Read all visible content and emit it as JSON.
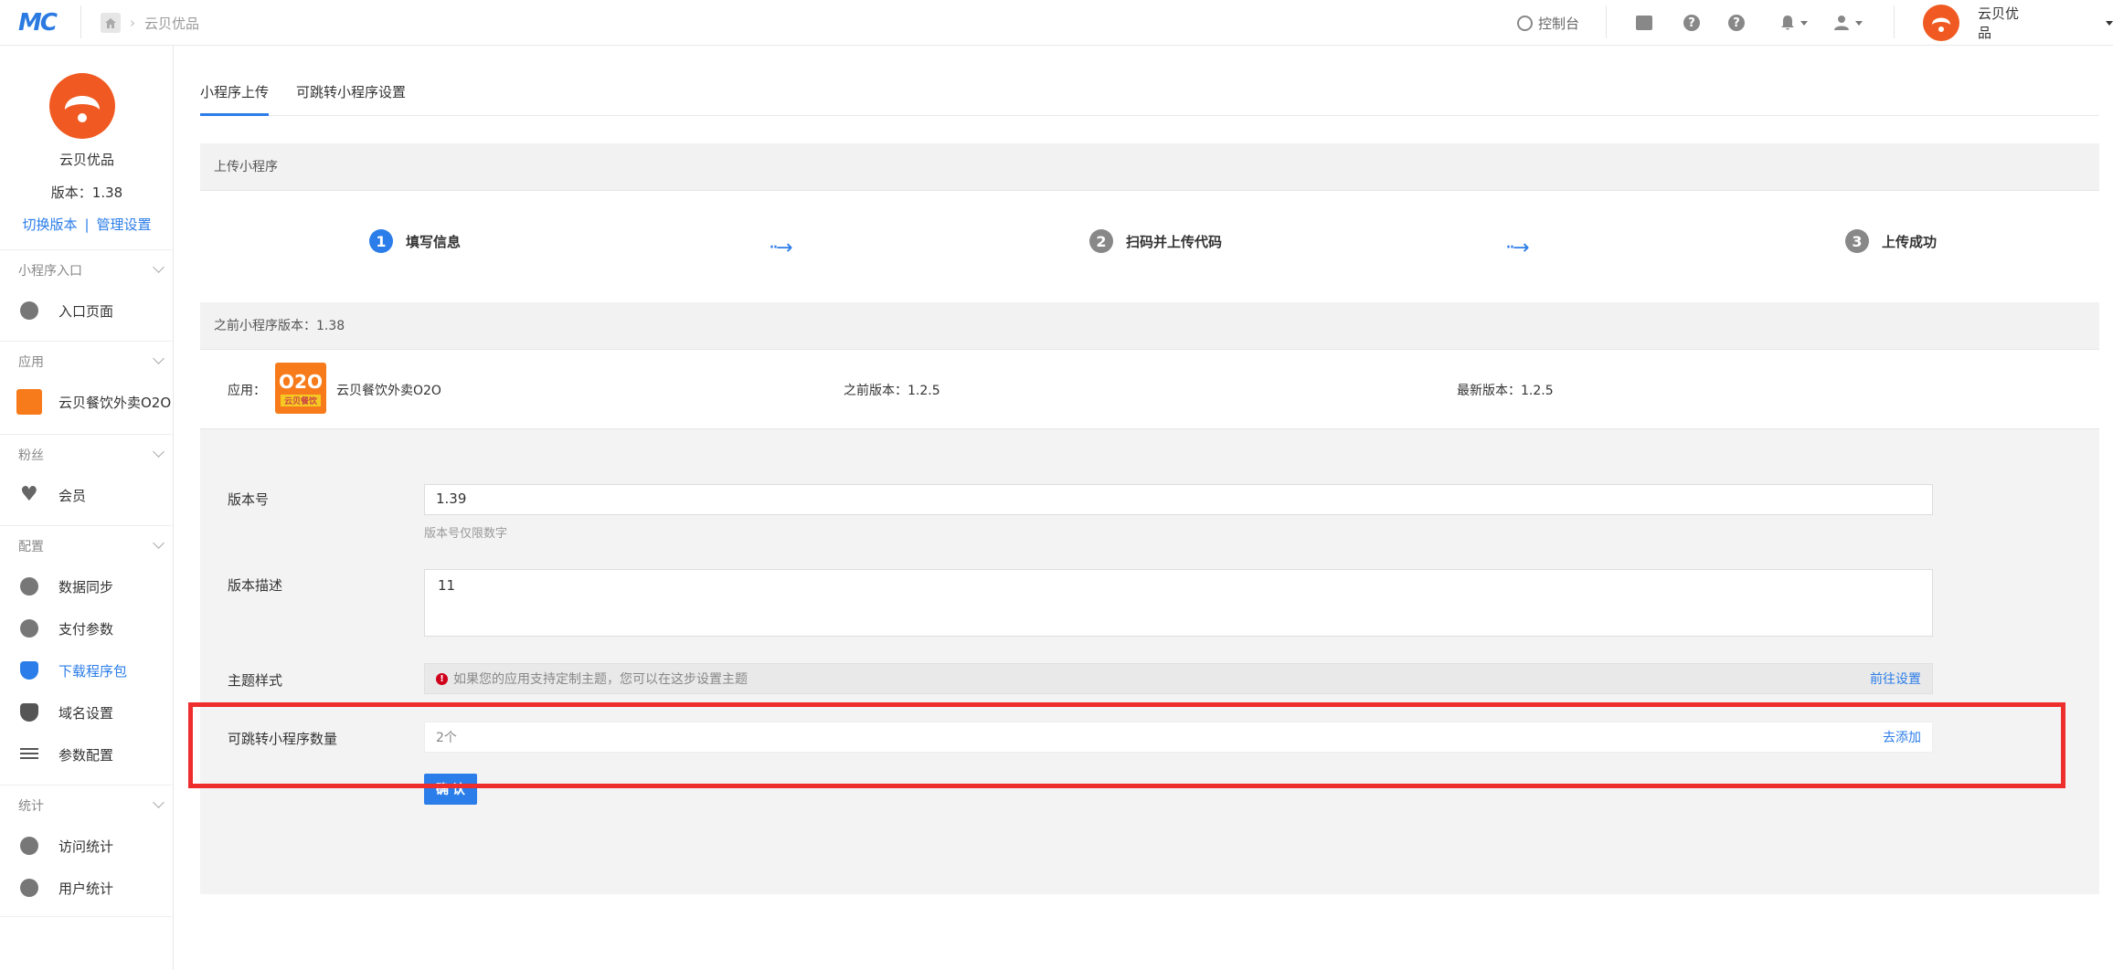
{
  "topbar": {
    "logo": "MC",
    "breadcrumb": "云贝优品",
    "console_label": "控制台",
    "account_name": "云贝优品"
  },
  "sidebar": {
    "store_name": "云贝优品",
    "version_label": "版本：1.38",
    "switch_version": "切换版本",
    "link_separator": "|",
    "manage_settings": "管理设置",
    "groups": [
      {
        "title": "小程序入口",
        "items": [
          {
            "label": "入口页面",
            "icon": "link-icon"
          }
        ]
      },
      {
        "title": "应用",
        "items": [
          {
            "label": "云贝餐饮外卖O2O",
            "icon": "o2o-app-icon"
          }
        ]
      },
      {
        "title": "粉丝",
        "items": [
          {
            "label": "会员",
            "icon": "heart-icon"
          }
        ]
      },
      {
        "title": "配置",
        "items": [
          {
            "label": "数据同步",
            "icon": "link-icon"
          },
          {
            "label": "支付参数",
            "icon": "gear-icon"
          },
          {
            "label": "下载程序包",
            "icon": "shield-icon",
            "active": true
          },
          {
            "label": "域名设置",
            "icon": "shield-icon"
          },
          {
            "label": "参数配置",
            "icon": "list-icon"
          }
        ]
      },
      {
        "title": "统计",
        "items": [
          {
            "label": "访问统计",
            "icon": "chart-icon"
          },
          {
            "label": "用户统计",
            "icon": "chart-icon"
          }
        ]
      }
    ]
  },
  "tabs": {
    "upload": "小程序上传",
    "jump_settings": "可跳转小程序设置"
  },
  "upload_panel_title": "上传小程序",
  "steps": [
    {
      "num": "1",
      "label": "填写信息"
    },
    {
      "num": "2",
      "label": "扫码并上传代码"
    },
    {
      "num": "3",
      "label": "上传成功"
    }
  ],
  "previous_version_title": "之前小程序版本：1.38",
  "app_row": {
    "app_label": "应用：",
    "app_icon_text": "O2O",
    "app_icon_sub": "云贝餐饮",
    "app_name": "云贝餐饮外卖O2O",
    "previous_version": "之前版本：1.2.5",
    "latest_version": "最新版本：1.2.5"
  },
  "form": {
    "version_label": "版本号",
    "version_value": "1.39",
    "version_hint": "版本号仅限数字",
    "desc_label": "版本描述",
    "desc_value": "11",
    "theme_label": "主题样式",
    "theme_hint": "如果您的应用支持定制主题，您可以在这步设置主题",
    "theme_link": "前往设置",
    "jump_label": "可跳转小程序数量",
    "jump_value": "2个",
    "jump_link": "去添加",
    "confirm_button": "确 认"
  },
  "colors": {
    "accent": "#2b7de9",
    "brand_orange": "#f05a22",
    "highlight_red": "#ee2d2d"
  }
}
